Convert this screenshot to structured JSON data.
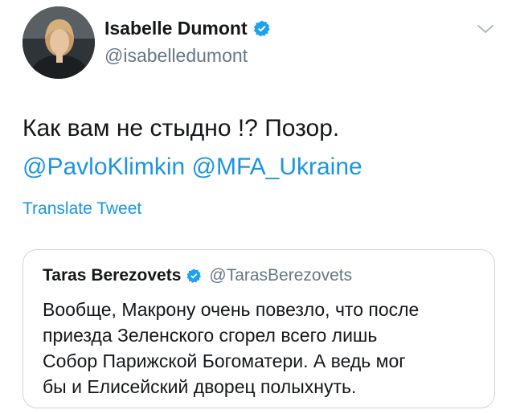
{
  "author": {
    "name": "Isabelle Dumont",
    "handle": "@isabelledumont"
  },
  "tweet": {
    "text": "Как вам не стыдно !?  Позор.",
    "mentions": [
      "@PavloKlimkin",
      "@MFA_Ukraine"
    ],
    "translate_label": "Translate Tweet"
  },
  "quote": {
    "name": "Taras Berezovets",
    "handle": "@TarasBerezovets",
    "text_lines": [
      "Вообще, Макрону очень повезло, что после",
      "приезда Зеленского сгорел всего лишь",
      "Собор Парижской Богоматери. А ведь мог",
      "бы и Елисейский дворец полыхнуть."
    ]
  },
  "colors": {
    "link": "#1b95e0",
    "verified": "#1da1f2",
    "secondary_text": "#657786",
    "border": "#ccd6dd"
  },
  "icons": {
    "verified": "verified-badge-icon",
    "more": "chevron-down-icon"
  }
}
